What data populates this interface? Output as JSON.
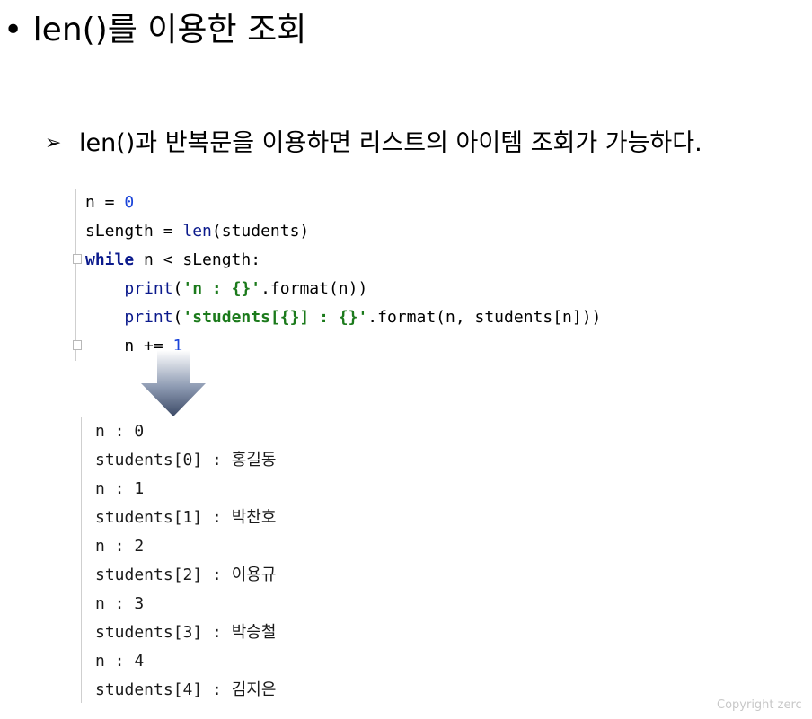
{
  "slide": {
    "title": "• len()를 이용한 조회",
    "bullet_marker": "➢",
    "bullet_text": "len()과 반복문을 이용하면 리스트의 아이템 조회가 가능하다.",
    "copyright": "Copyright zerc"
  },
  "code": {
    "l1_a": "n = ",
    "l1_num": "0",
    "l2_a": "sLength = ",
    "l2_fn": "len",
    "l2_b": "(students)",
    "l3_kw": "while",
    "l3_b": " n < sLength:",
    "l4_fn": "print",
    "l4_a": "(",
    "l4_str": "'n : {}'",
    "l4_b": ".format(n))",
    "l5_fn": "print",
    "l5_a": "(",
    "l5_str": "'students[{}] : {}'",
    "l5_b": ".format(n, students[n]))",
    "l6_a": "n += ",
    "l6_num": "1"
  },
  "output": [
    "n : 0",
    "students[0] : 홍길동",
    "n : 1",
    "students[1] : 박찬호",
    "n : 2",
    "students[2] : 이용규",
    "n : 3",
    "students[3] : 박승철",
    "n : 4",
    "students[4] : 김지은"
  ],
  "icons": {
    "flow_arrow": "down-arrow-icon",
    "fold_marker": "fold-marker-icon"
  },
  "colors": {
    "rule": "#4a78c8",
    "keyword": "#0b1a8c",
    "number": "#1a44d9",
    "string": "#1b7a1b"
  }
}
